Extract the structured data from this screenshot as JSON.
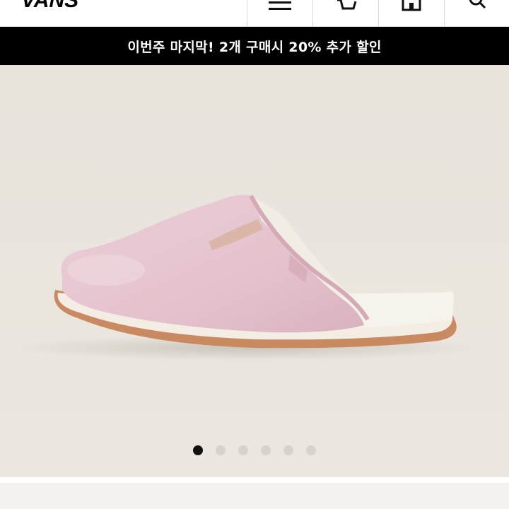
{
  "header": {
    "logo_text": "VANS",
    "icons": [
      "menu-icon",
      "cart-icon",
      "store-icon",
      "search-icon"
    ]
  },
  "banner": {
    "text": "이번주 마지막! 2개 구매시 20% 추가 할인"
  },
  "hero": {
    "product_image": "pink-suede-mule-slipper",
    "colors": {
      "background": "#e9e5de",
      "upper": "#e6c6d0",
      "sole": "#c98a62",
      "footbed": "#f4f1ea"
    }
  },
  "carousel": {
    "total": 6,
    "active_index": 1
  }
}
